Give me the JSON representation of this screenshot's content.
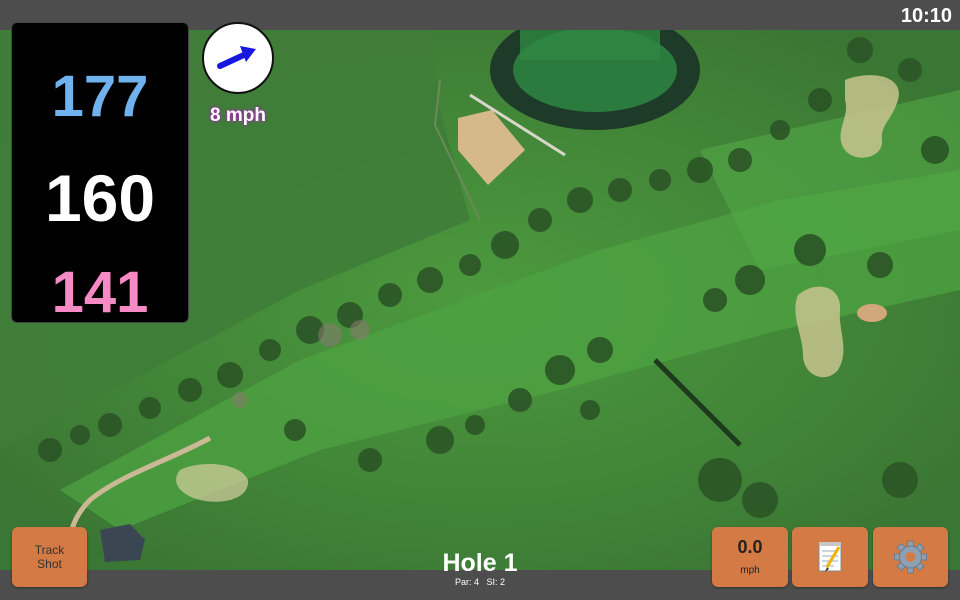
{
  "status_bar": {
    "time": "10:10"
  },
  "yardage": {
    "back": "177",
    "middle": "160",
    "front": "141"
  },
  "wind": {
    "speed_label": "8 mph",
    "direction_icon": "arrow-icon"
  },
  "hole": {
    "title": "Hole 1",
    "par_label": "Par: 4",
    "si_label": "SI: 2"
  },
  "buttons": {
    "track_shot_line1": "Track",
    "track_shot_line2": "Shot",
    "speed_value": "0.0",
    "speed_unit": "mph",
    "notes_icon": "notepad-icon",
    "settings_icon": "gear-icon"
  },
  "colors": {
    "back_yardage": "#6fb2ee",
    "middle_yardage": "#ffffff",
    "front_yardage": "#f58ac4",
    "button": "#d47a45",
    "wind_label_glow": "#b020c0"
  }
}
